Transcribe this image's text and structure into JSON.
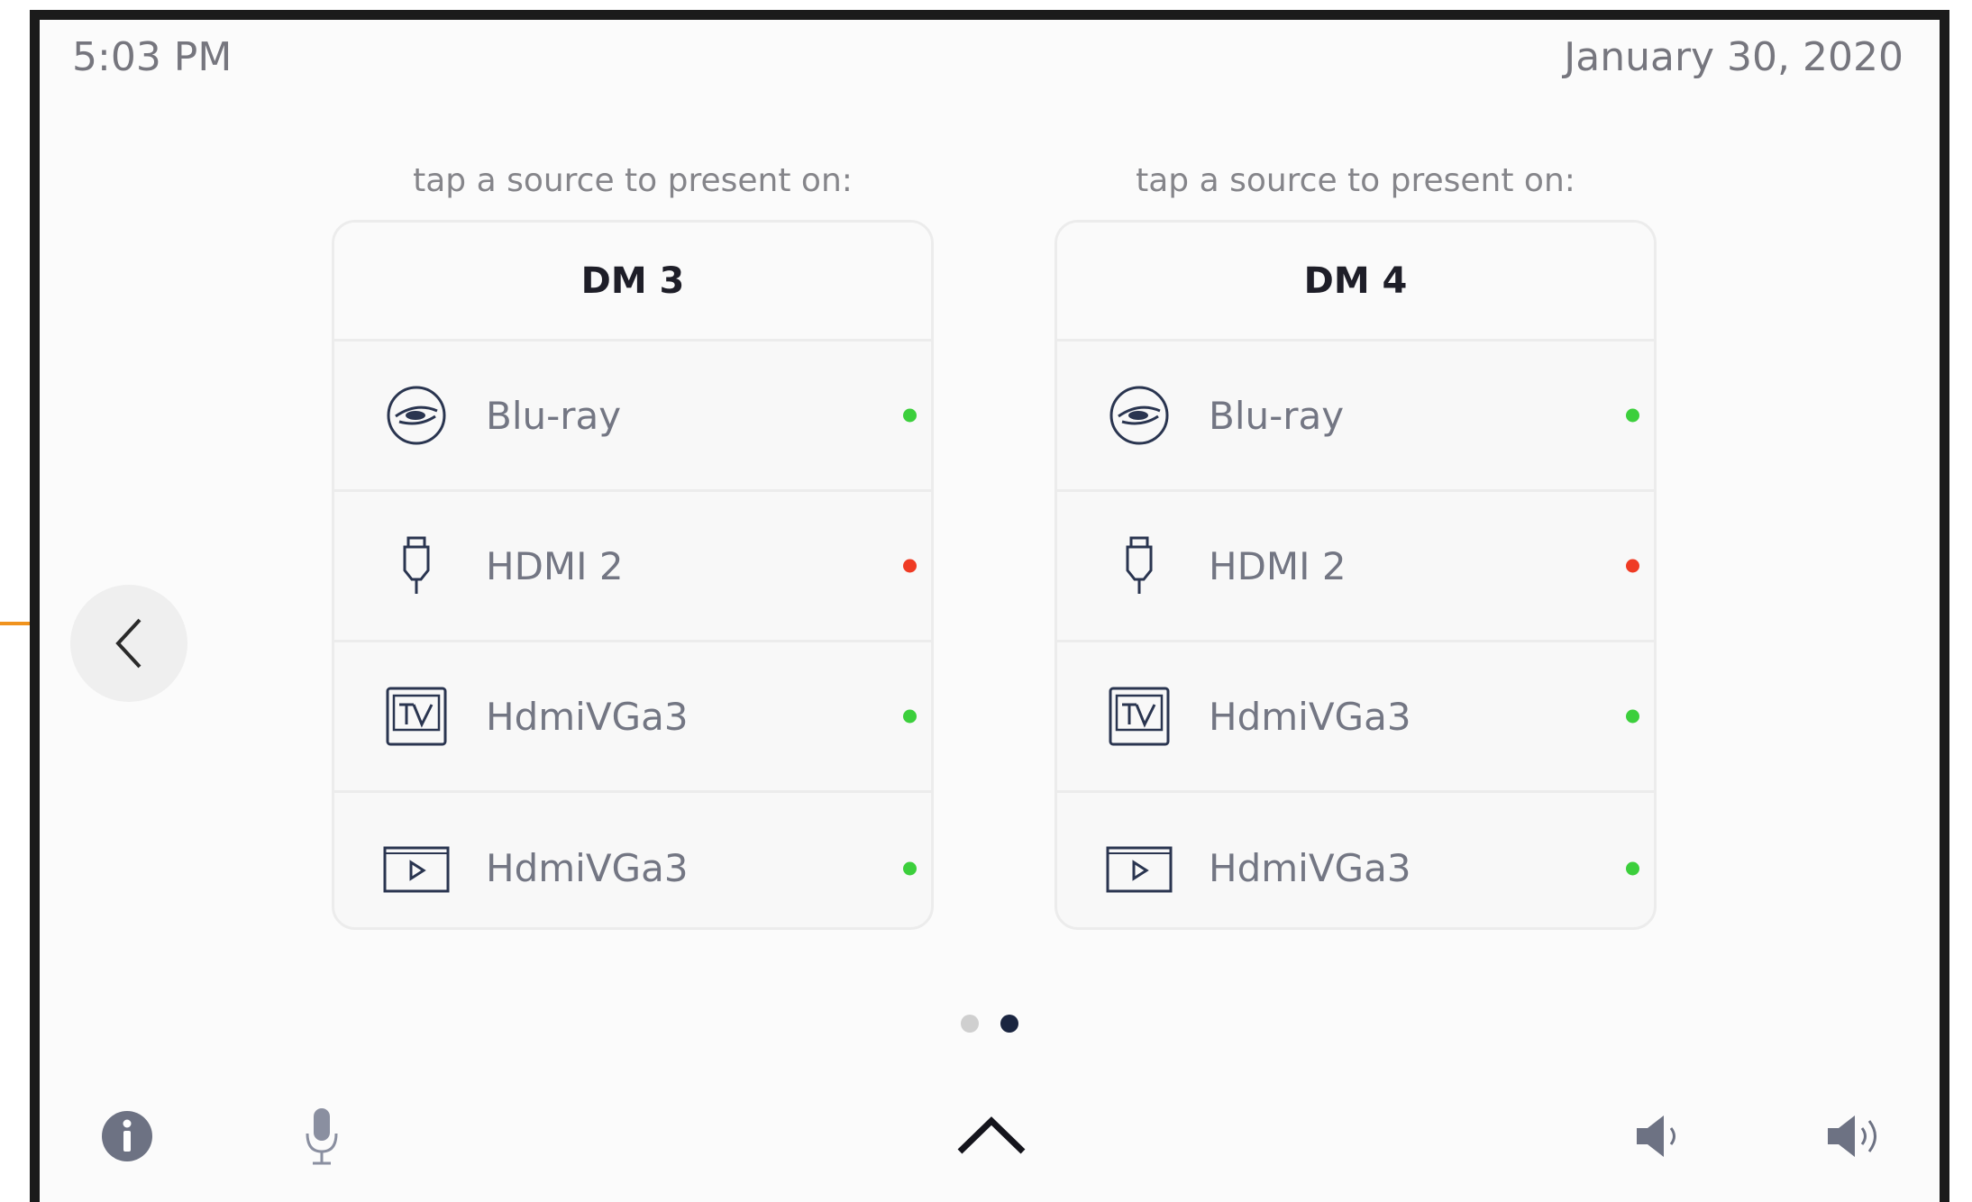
{
  "header": {
    "time": "5:03 PM",
    "date": "January 30, 2020"
  },
  "panels": [
    {
      "prompt": "tap a source to present on:",
      "title": "DM 3",
      "sources": [
        {
          "label": "Blu-ray",
          "icon": "blu-ray-icon",
          "status": "online"
        },
        {
          "label": "HDMI 2",
          "icon": "hdmi-icon",
          "status": "offline"
        },
        {
          "label": "HdmiVGa3",
          "icon": "tv-icon",
          "status": "online"
        },
        {
          "label": "HdmiVGa3",
          "icon": "media-player-icon",
          "status": "online"
        }
      ]
    },
    {
      "prompt": "tap a source to present on:",
      "title": "DM 4",
      "sources": [
        {
          "label": "Blu-ray",
          "icon": "blu-ray-icon",
          "status": "online"
        },
        {
          "label": "HDMI 2",
          "icon": "hdmi-icon",
          "status": "offline"
        },
        {
          "label": "HdmiVGa3",
          "icon": "tv-icon",
          "status": "online"
        },
        {
          "label": "HdmiVGa3",
          "icon": "media-player-icon",
          "status": "online"
        }
      ]
    }
  ],
  "pagination": {
    "page_count": 2,
    "current_page": 2
  },
  "footer": {
    "icons": [
      "info-icon",
      "microphone-icon",
      "chevron-up-icon",
      "volume-down-icon",
      "volume-up-icon"
    ]
  },
  "colors": {
    "online": "#3ccf3c",
    "offline": "#ef3b24",
    "annotation_arrow": "#f0931e",
    "pager_active": "#1a2540",
    "pager_inactive": "#cfcfcf",
    "text_dark": "#1e1e28",
    "text_muted": "#737683"
  }
}
